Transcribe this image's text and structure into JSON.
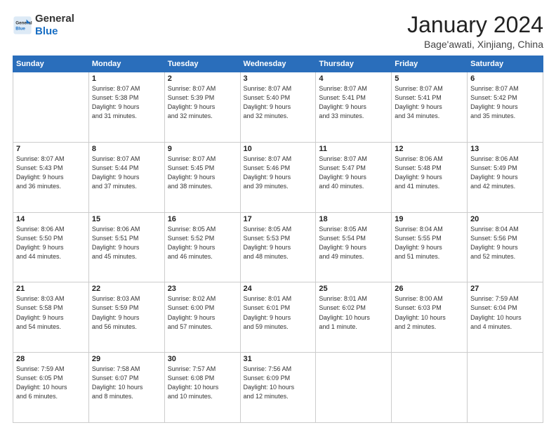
{
  "logo": {
    "line1": "General",
    "line2": "Blue"
  },
  "title": "January 2024",
  "subtitle": "Bage'awati, Xinjiang, China",
  "days_header": [
    "Sunday",
    "Monday",
    "Tuesday",
    "Wednesday",
    "Thursday",
    "Friday",
    "Saturday"
  ],
  "weeks": [
    [
      {
        "num": "",
        "detail": ""
      },
      {
        "num": "1",
        "detail": "Sunrise: 8:07 AM\nSunset: 5:38 PM\nDaylight: 9 hours\nand 31 minutes."
      },
      {
        "num": "2",
        "detail": "Sunrise: 8:07 AM\nSunset: 5:39 PM\nDaylight: 9 hours\nand 32 minutes."
      },
      {
        "num": "3",
        "detail": "Sunrise: 8:07 AM\nSunset: 5:40 PM\nDaylight: 9 hours\nand 32 minutes."
      },
      {
        "num": "4",
        "detail": "Sunrise: 8:07 AM\nSunset: 5:41 PM\nDaylight: 9 hours\nand 33 minutes."
      },
      {
        "num": "5",
        "detail": "Sunrise: 8:07 AM\nSunset: 5:41 PM\nDaylight: 9 hours\nand 34 minutes."
      },
      {
        "num": "6",
        "detail": "Sunrise: 8:07 AM\nSunset: 5:42 PM\nDaylight: 9 hours\nand 35 minutes."
      }
    ],
    [
      {
        "num": "7",
        "detail": "Sunrise: 8:07 AM\nSunset: 5:43 PM\nDaylight: 9 hours\nand 36 minutes."
      },
      {
        "num": "8",
        "detail": "Sunrise: 8:07 AM\nSunset: 5:44 PM\nDaylight: 9 hours\nand 37 minutes."
      },
      {
        "num": "9",
        "detail": "Sunrise: 8:07 AM\nSunset: 5:45 PM\nDaylight: 9 hours\nand 38 minutes."
      },
      {
        "num": "10",
        "detail": "Sunrise: 8:07 AM\nSunset: 5:46 PM\nDaylight: 9 hours\nand 39 minutes."
      },
      {
        "num": "11",
        "detail": "Sunrise: 8:07 AM\nSunset: 5:47 PM\nDaylight: 9 hours\nand 40 minutes."
      },
      {
        "num": "12",
        "detail": "Sunrise: 8:06 AM\nSunset: 5:48 PM\nDaylight: 9 hours\nand 41 minutes."
      },
      {
        "num": "13",
        "detail": "Sunrise: 8:06 AM\nSunset: 5:49 PM\nDaylight: 9 hours\nand 42 minutes."
      }
    ],
    [
      {
        "num": "14",
        "detail": "Sunrise: 8:06 AM\nSunset: 5:50 PM\nDaylight: 9 hours\nand 44 minutes."
      },
      {
        "num": "15",
        "detail": "Sunrise: 8:06 AM\nSunset: 5:51 PM\nDaylight: 9 hours\nand 45 minutes."
      },
      {
        "num": "16",
        "detail": "Sunrise: 8:05 AM\nSunset: 5:52 PM\nDaylight: 9 hours\nand 46 minutes."
      },
      {
        "num": "17",
        "detail": "Sunrise: 8:05 AM\nSunset: 5:53 PM\nDaylight: 9 hours\nand 48 minutes."
      },
      {
        "num": "18",
        "detail": "Sunrise: 8:05 AM\nSunset: 5:54 PM\nDaylight: 9 hours\nand 49 minutes."
      },
      {
        "num": "19",
        "detail": "Sunrise: 8:04 AM\nSunset: 5:55 PM\nDaylight: 9 hours\nand 51 minutes."
      },
      {
        "num": "20",
        "detail": "Sunrise: 8:04 AM\nSunset: 5:56 PM\nDaylight: 9 hours\nand 52 minutes."
      }
    ],
    [
      {
        "num": "21",
        "detail": "Sunrise: 8:03 AM\nSunset: 5:58 PM\nDaylight: 9 hours\nand 54 minutes."
      },
      {
        "num": "22",
        "detail": "Sunrise: 8:03 AM\nSunset: 5:59 PM\nDaylight: 9 hours\nand 56 minutes."
      },
      {
        "num": "23",
        "detail": "Sunrise: 8:02 AM\nSunset: 6:00 PM\nDaylight: 9 hours\nand 57 minutes."
      },
      {
        "num": "24",
        "detail": "Sunrise: 8:01 AM\nSunset: 6:01 PM\nDaylight: 9 hours\nand 59 minutes."
      },
      {
        "num": "25",
        "detail": "Sunrise: 8:01 AM\nSunset: 6:02 PM\nDaylight: 10 hours\nand 1 minute."
      },
      {
        "num": "26",
        "detail": "Sunrise: 8:00 AM\nSunset: 6:03 PM\nDaylight: 10 hours\nand 2 minutes."
      },
      {
        "num": "27",
        "detail": "Sunrise: 7:59 AM\nSunset: 6:04 PM\nDaylight: 10 hours\nand 4 minutes."
      }
    ],
    [
      {
        "num": "28",
        "detail": "Sunrise: 7:59 AM\nSunset: 6:05 PM\nDaylight: 10 hours\nand 6 minutes."
      },
      {
        "num": "29",
        "detail": "Sunrise: 7:58 AM\nSunset: 6:07 PM\nDaylight: 10 hours\nand 8 minutes."
      },
      {
        "num": "30",
        "detail": "Sunrise: 7:57 AM\nSunset: 6:08 PM\nDaylight: 10 hours\nand 10 minutes."
      },
      {
        "num": "31",
        "detail": "Sunrise: 7:56 AM\nSunset: 6:09 PM\nDaylight: 10 hours\nand 12 minutes."
      },
      {
        "num": "",
        "detail": ""
      },
      {
        "num": "",
        "detail": ""
      },
      {
        "num": "",
        "detail": ""
      }
    ]
  ]
}
